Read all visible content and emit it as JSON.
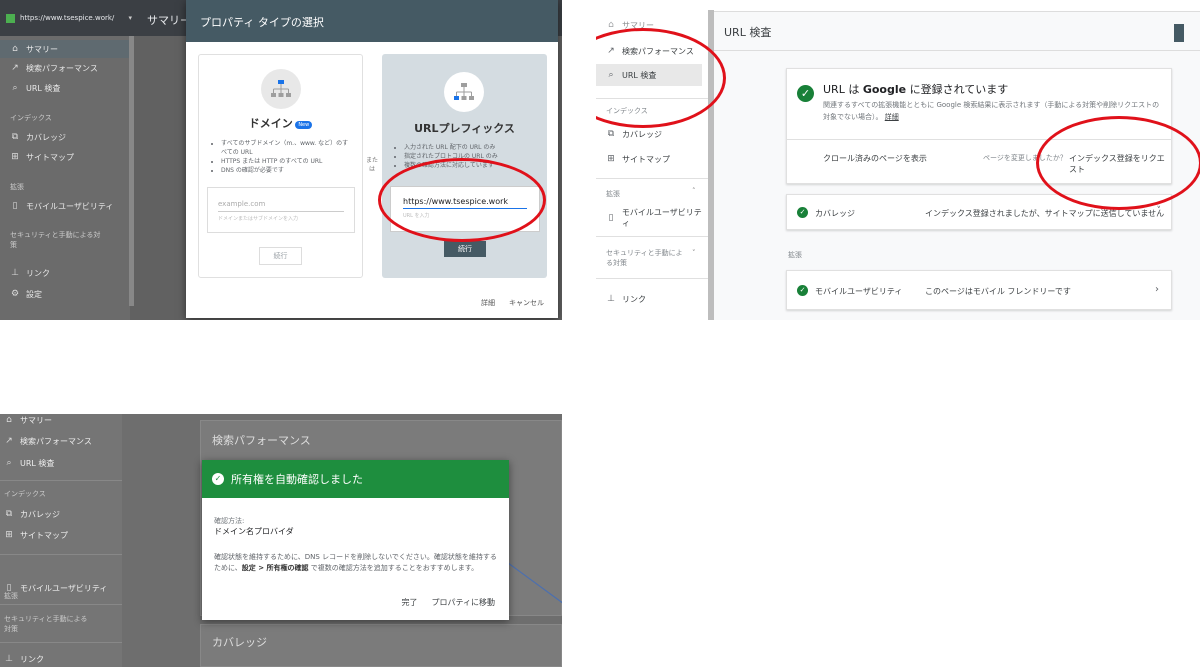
{
  "shot1": {
    "url": "https://www.tsespice.work/",
    "header_title": "サマリー",
    "sidebar": {
      "items": [
        "サマリー",
        "検索パフォーマンス",
        "URL 検査"
      ],
      "section_index": "インデックス",
      "index_items": [
        "カバレッジ",
        "サイトマップ"
      ],
      "section_ext": "拡張",
      "ext_items": [
        "モバイルユーザビリティ"
      ],
      "section_sec": "セキュリティと手動による対策",
      "bottom_items": [
        "リンク",
        "設定"
      ]
    },
    "dialog": {
      "title": "プロパティ タイプの選択",
      "domain": {
        "title": "ドメイン",
        "badge": "New",
        "bullets": [
          "すべてのサブドメイン（m.、www. など）のすべての URL",
          "HTTPS または HTTP のすべての URL",
          "DNS の確認が必要です"
        ],
        "input_placeholder": "example.com",
        "input_hint": "ドメインまたはサブドメインを入力",
        "button": "続行"
      },
      "or": "また は",
      "prefix": {
        "title": "URLプレフィックス",
        "bullets": [
          "入力された URL 配下の URL のみ",
          "指定されたプロトコルの URL のみ",
          "複数の確認方法に対応しています"
        ],
        "input_value": "https://www.tsespice.work",
        "input_hint": "URL を入力",
        "button": "続行"
      },
      "footer_details": "詳細",
      "footer_cancel": "キャンセル"
    }
  },
  "shot2": {
    "sidebar": {
      "top_partial": "サマリー",
      "items": [
        "検索パフォーマンス",
        "URL 検査"
      ],
      "section_index": "インデックス",
      "index_items": [
        "カバレッジ",
        "サイトマップ"
      ],
      "section_ext": "拡張",
      "ext_items": [
        "モバイルユーザビリティ"
      ],
      "section_sec": "セキュリティと手動による対策",
      "bottom_items": [
        "リンク"
      ]
    },
    "page_title": "URL 検査",
    "status": {
      "title_pre": "URL は ",
      "title_google": "Google",
      "title_post": " に登録されています",
      "desc": "関連するすべての拡張機能とともに Google 検索結果に表示されます（手動による対策や削除リクエストの対象でない場合）。",
      "link": "詳細"
    },
    "crawled_link": "クロール済みのページを表示",
    "changed_q": "ページを変更しましたか？",
    "request_index": "インデックス登録をリクエスト",
    "coverage_label": "カバレッジ",
    "coverage_value": "インデックス登録されましたが、サイトマップに送信していません",
    "ext_label": "拡張",
    "mobile_label": "モバイルユーザビリティ",
    "mobile_value": "このページはモバイル フレンドリーです"
  },
  "shot3": {
    "sidebar": {
      "items": [
        "サマリー",
        "検索パフォーマンス",
        "URL 検査"
      ],
      "section_index": "インデックス",
      "index_items": [
        "カバレッジ",
        "サイトマップ"
      ],
      "section_ext": "拡張",
      "ext_items": [
        "モバイルユーザビリティ"
      ],
      "section_sec": "セキュリティと手動による対策",
      "bottom_items": [
        "リンク"
      ]
    },
    "bg_title1": "検索パフォーマンス",
    "bg_title2": "カバレッジ",
    "dialog": {
      "header": "所有権を自動確認しました",
      "method_label": "確認方法:",
      "method_value": "ドメイン名プロバイダ",
      "body_pre": "確認状態を維持するために、DNS レコードを削除しないでください。確認状態を維持するために、",
      "body_bold": "設定 > 所有権の確認",
      "body_post": " で複数の確認方法を追加することをおすすめします。",
      "btn_done": "完了",
      "btn_go": "プロパティに移動"
    }
  }
}
